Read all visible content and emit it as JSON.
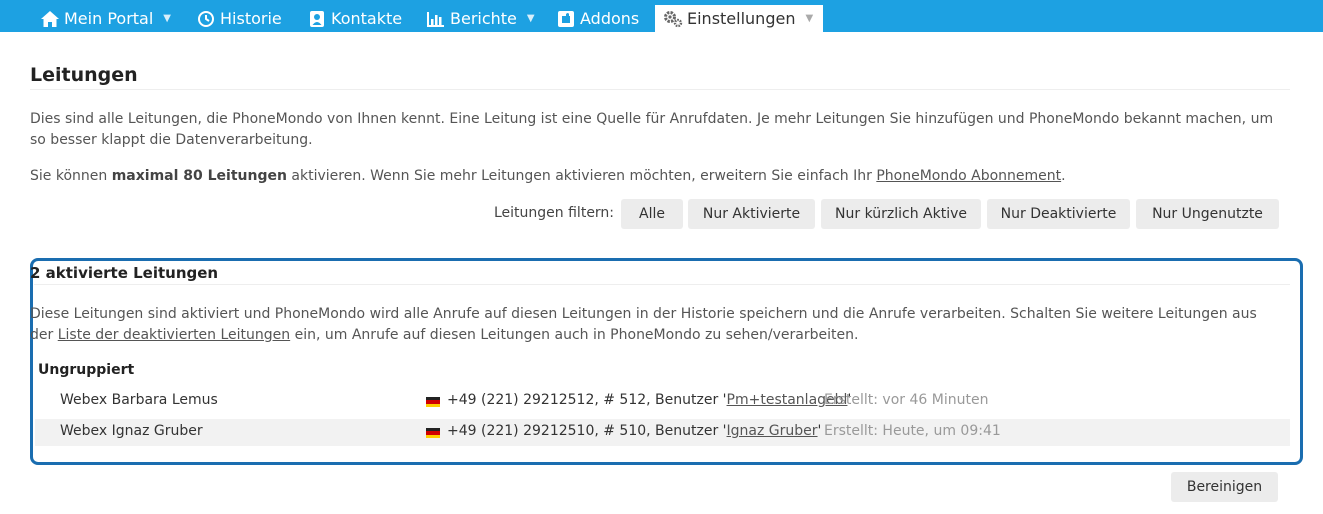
{
  "nav": {
    "items": [
      {
        "label": "Mein Portal",
        "icon": "home-icon"
      },
      {
        "label": "Historie",
        "icon": "history-icon"
      },
      {
        "label": "Kontakte",
        "icon": "contacts-icon"
      },
      {
        "label": "Berichte",
        "icon": "chart-icon"
      },
      {
        "label": "Addons",
        "icon": "puzzle-icon"
      },
      {
        "label": "Einstellungen",
        "icon": "gears-icon",
        "active": true
      }
    ]
  },
  "page": {
    "title": "Leitungen",
    "intro": "Dies sind alle Leitungen, die PhoneMondo von Ihnen kennt. Eine Leitung ist eine Quelle für Anrufdaten. Je mehr Leitungen Sie hinzufügen und PhoneMondo bekannt machen, um so besser klappt die Datenverarbeitung.",
    "limit_prefix": "Sie können ",
    "limit_bold": "maximal 80 Leitungen",
    "limit_middle": " aktivieren. Wenn Sie mehr Leitungen aktivieren möchten, erweitern Sie einfach Ihr ",
    "limit_link": "PhoneMondo Abonnement",
    "limit_suffix": "."
  },
  "filter": {
    "label": "Leitungen filtern:",
    "buttons": [
      "Alle",
      "Nur Aktivierte",
      "Nur kürzlich Aktive",
      "Nur Deaktivierte",
      "Nur Ungenutzte"
    ]
  },
  "active_section": {
    "title": "2 aktivierte Leitungen",
    "desc_prefix": "Diese Leitungen sind aktiviert und PhoneMondo wird alle Anrufe auf diesen Leitungen in der Historie speichern und die Anrufe verarbeiten. Schalten Sie weitere Leitungen aus der ",
    "desc_link": "Liste der deaktivierten Leitungen",
    "desc_suffix": " ein, um Anrufe auf diesen Leitungen auch in PhoneMondo zu sehen/verarbeiten.",
    "group": "Ungruppiert",
    "lines": [
      {
        "name": "Webex Barbara Lemus",
        "number_prefix": "+49 (221) 29212512, # 512, Benutzer '",
        "user": "Pm+testanlagebl",
        "number_suffix": "'",
        "created": "Erstellt: vor 46 Minuten"
      },
      {
        "name": "Webex Ignaz Gruber",
        "number_prefix": "+49 (221) 29212510, # 510, Benutzer '",
        "user": "Ignaz Gruber",
        "number_suffix": "'",
        "created": "Erstellt: Heute, um 09:41"
      }
    ]
  },
  "cleanup_button": "Bereinigen",
  "colors": {
    "nav_bg": "#1da1e2",
    "box_border": "#1a6db0",
    "button_bg": "#ececec",
    "alt_row_bg": "#f2f2f2"
  },
  "flag": "german-flag-icon"
}
